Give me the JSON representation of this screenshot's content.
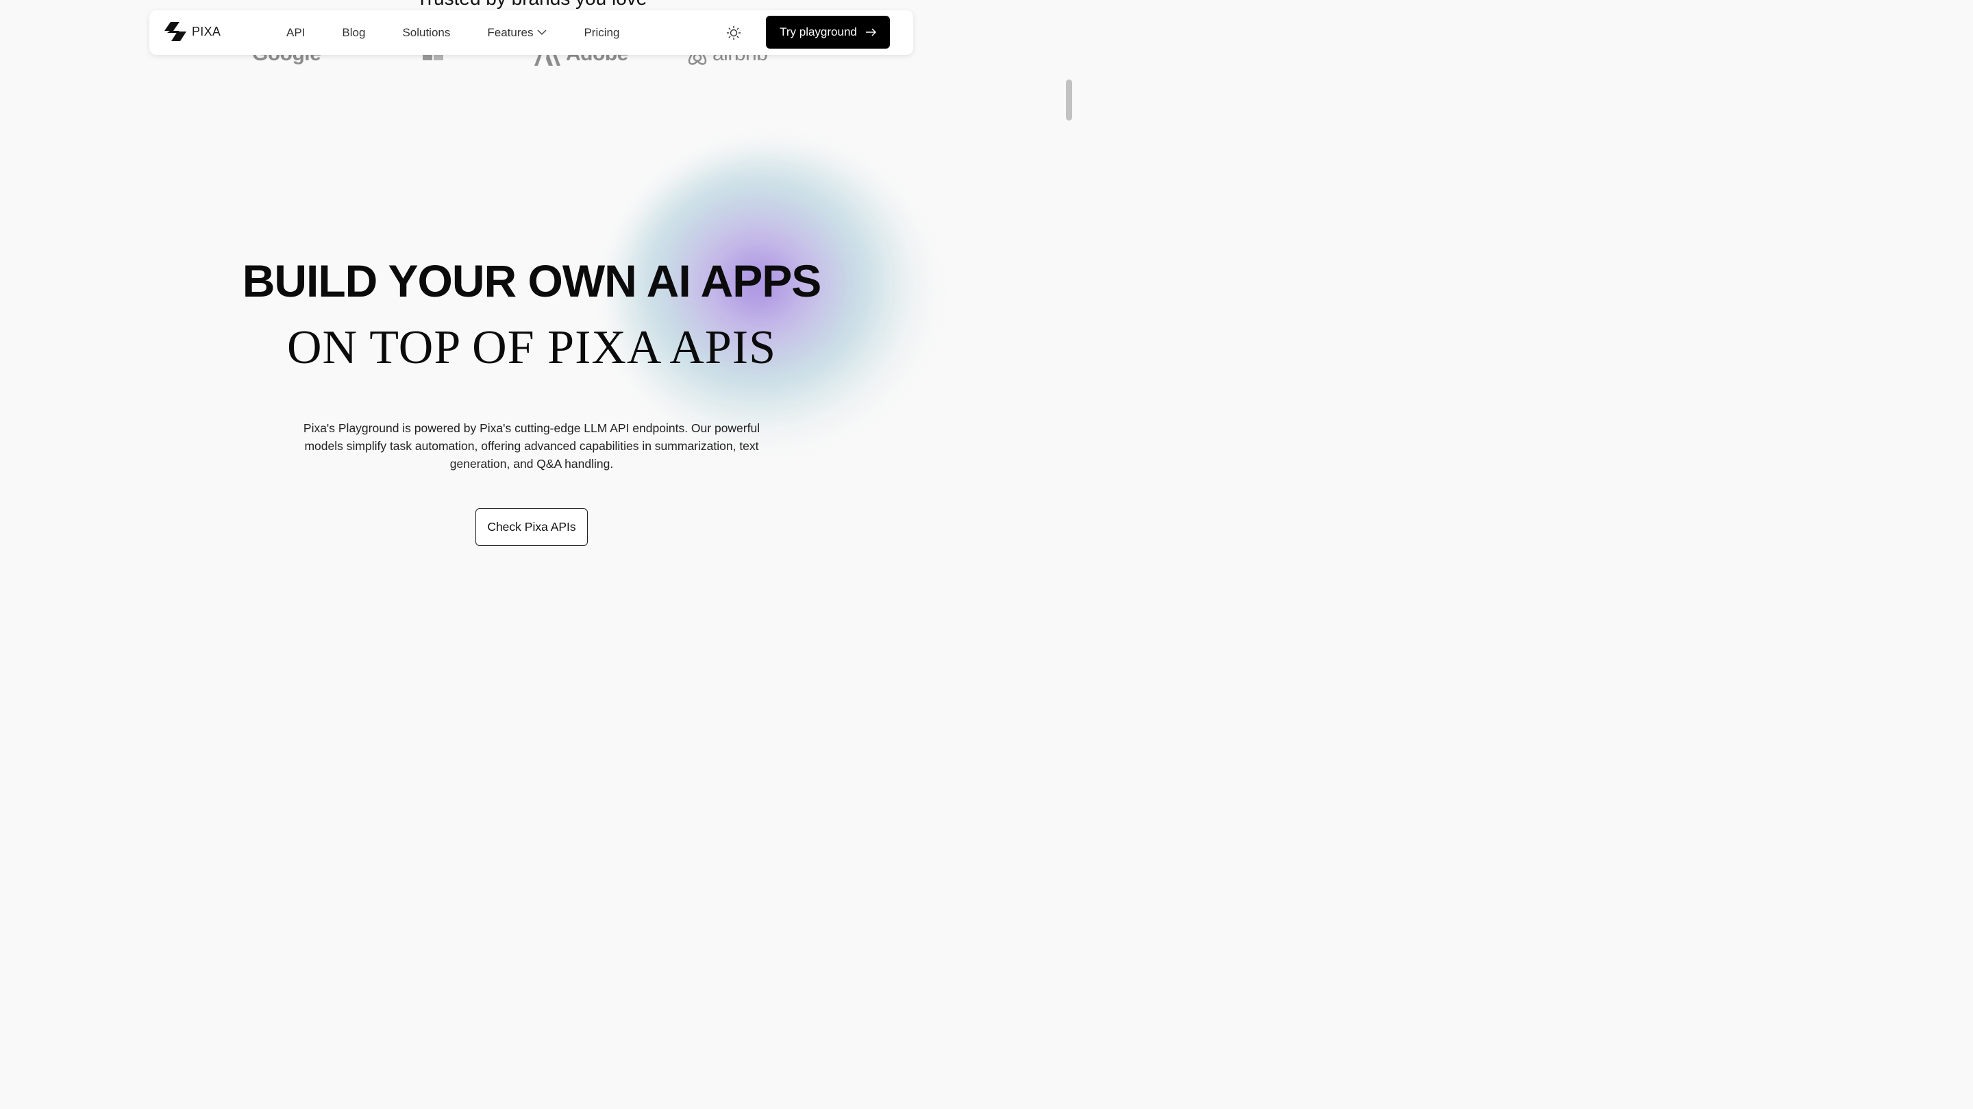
{
  "trusted": {
    "heading": "Trusted by brands you love",
    "logos": [
      "Google",
      "Microsoft",
      "Adobe",
      "airbnb"
    ]
  },
  "navbar": {
    "brand": "PIXA",
    "links": [
      {
        "label": "API"
      },
      {
        "label": "Blog"
      },
      {
        "label": "Solutions"
      },
      {
        "label": "Features"
      },
      {
        "label": "Pricing"
      }
    ],
    "cta_label": "Try playground"
  },
  "hero": {
    "title_line1": "BUILD YOUR OWN AI APPS",
    "title_line2": "ON TOP OF PIXA APIS",
    "description": "Pixa's Playground is powered by Pixa's cutting-edge LLM API endpoints. Our powerful models simplify task automation, offering advanced capabilities in summarization, text generation, and Q&A handling.",
    "button_label": "Check Pixa APIs"
  },
  "icons": {
    "logo": "pixa-logo-icon",
    "theme": "sun-icon",
    "dropdown": "chevron-down-icon",
    "cta": "arrow-right-icon"
  },
  "colors": {
    "background": "#f9f9f9",
    "primary": "#000000",
    "glow_purple": "#9678dc",
    "glow_teal": "#8cbecd"
  }
}
